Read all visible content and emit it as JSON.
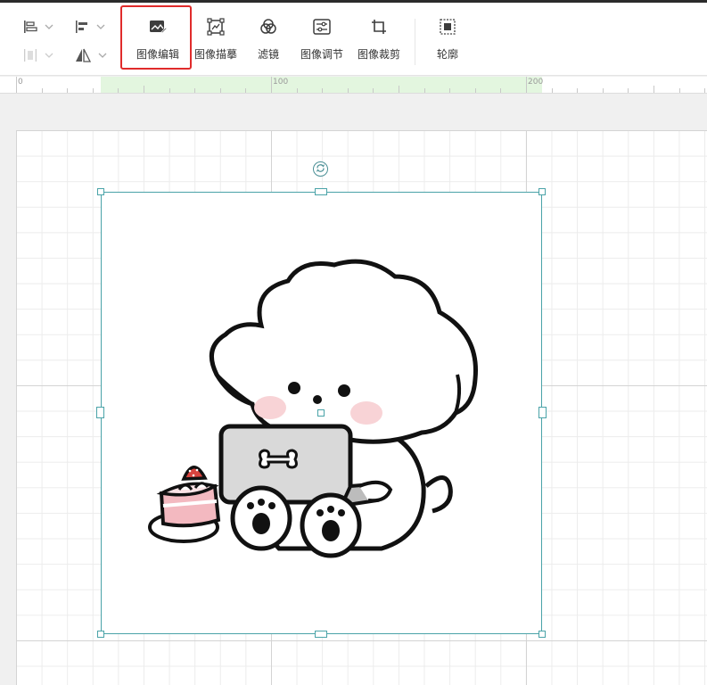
{
  "toolbar": {
    "controls": [
      {
        "id": "align-left",
        "icon": "align-left-icon"
      },
      {
        "id": "distribute",
        "icon": "distribute-icon"
      },
      {
        "id": "align-top",
        "icon": "align-top-icon"
      },
      {
        "id": "flip",
        "icon": "flip-icon"
      }
    ],
    "buttons": [
      {
        "label": "图像编辑",
        "icon": "image-edit-icon"
      },
      {
        "label": "图像描摹",
        "icon": "image-trace-icon"
      },
      {
        "label": "滤镜",
        "icon": "filter-icon"
      },
      {
        "label": "图像调节",
        "icon": "image-adjust-icon"
      },
      {
        "label": "图像裁剪",
        "icon": "crop-icon"
      },
      {
        "label": "轮廓",
        "icon": "outline-icon"
      }
    ],
    "highlighted_button": "图像编辑"
  },
  "ruler": {
    "labels": [
      "0",
      "100",
      "200"
    ]
  },
  "colors": {
    "selection": "#4aa3a8",
    "highlight": "#e02b2b",
    "ruler_highlight": "#e3f6df"
  },
  "canvas": {
    "image_subject": "cartoon-dog-with-laptop-and-cake"
  }
}
